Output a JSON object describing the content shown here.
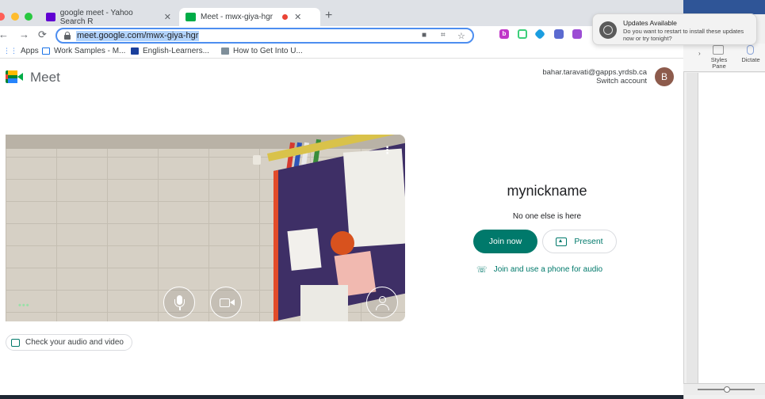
{
  "browser": {
    "tabs": [
      {
        "title": "google meet - Yahoo Search R",
        "active": false
      },
      {
        "title": "Meet - mwx-giya-hgr",
        "active": true
      }
    ],
    "url": "meet.google.com/mwx-giya-hgr",
    "bookmarks": [
      {
        "label": "Apps"
      },
      {
        "label": "Work Samples - M..."
      },
      {
        "label": "English-Learners..."
      },
      {
        "label": "How to Get Into U..."
      }
    ],
    "colors": {
      "tabstrip": "#dee1e6",
      "focus_ring": "#4d8ef0"
    }
  },
  "meet": {
    "product_name": "Meet",
    "account_email": "bahar.taravati@gapps.yrdsb.ca",
    "switch_account": "Switch account",
    "avatar_letter": "B",
    "nickname": "mynickname",
    "status": "No one else is here",
    "join_label": "Join now",
    "present_label": "Present",
    "phone_label": "Join and use a phone for audio",
    "check_label": "Check your audio and video",
    "colors": {
      "primary": "#00796b",
      "avatar": "#8d5b4c"
    }
  },
  "notification": {
    "title": "Updates Available",
    "body": "Do you want to restart to install these updates now or try tonight?"
  },
  "word": {
    "ribbon_styles": "Styles Pane",
    "ribbon_dictate": "Dictate"
  }
}
